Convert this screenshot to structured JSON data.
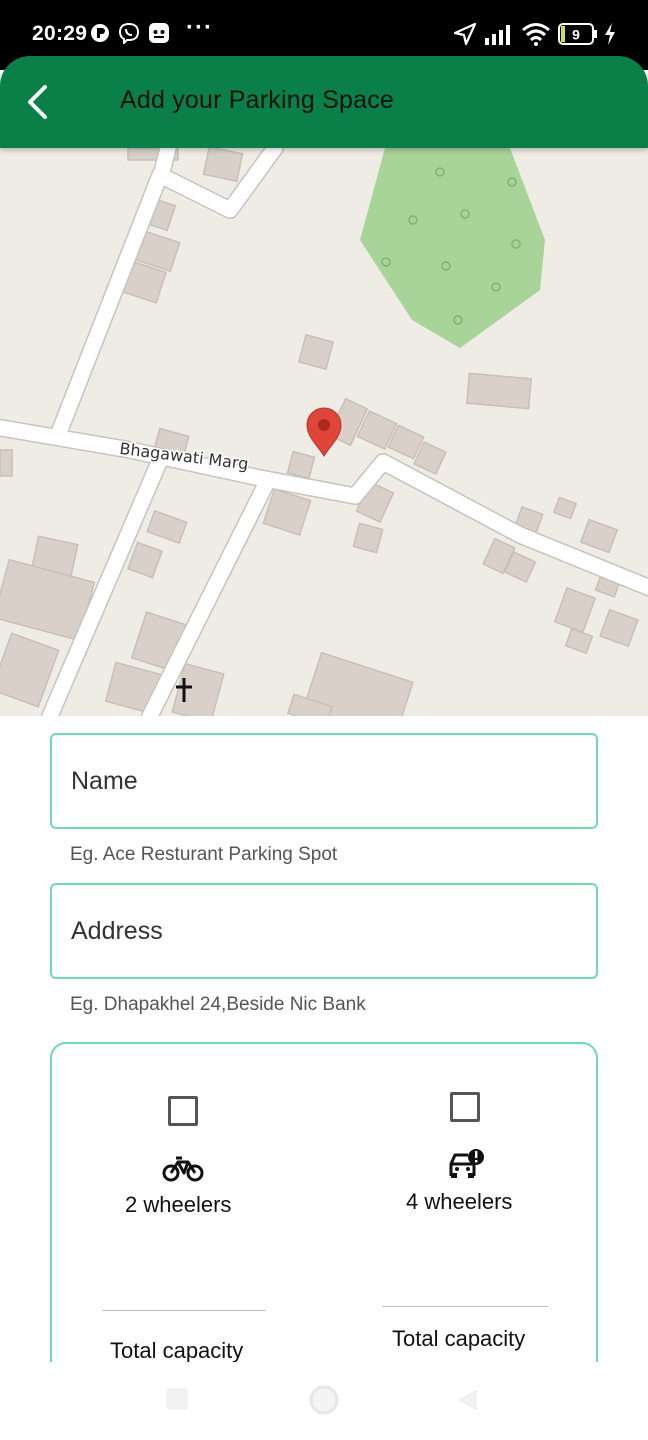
{
  "status_bar": {
    "time": "20:29",
    "battery_level": "9",
    "icons": [
      "messenger-icon",
      "viber-icon",
      "notification-icon",
      "more-dots-icon",
      "location-arrow-icon",
      "signal-icon",
      "wifi-icon",
      "battery-icon",
      "charging-icon"
    ]
  },
  "app_bar": {
    "title": "Add your Parking Space",
    "background_color": "#0a8048"
  },
  "map": {
    "street_label": "Bhagawati Marg",
    "marker_color": "#e0453a",
    "park_color": "#a8d49a"
  },
  "form": {
    "name_placeholder": "Name",
    "name_helper": "Eg. Ace Resturant Parking Spot",
    "address_placeholder": "Address",
    "address_helper": "Eg. Dhapakhel 24,Beside Nic Bank",
    "border_color": "#6fdcae",
    "two_wheelers": {
      "label": "2 wheelers",
      "checked": false,
      "capacity_label": "Total capacity"
    },
    "four_wheelers": {
      "label": "4 wheelers",
      "checked": false,
      "capacity_label": "Total capacity"
    }
  },
  "nav_bar": {
    "buttons": [
      "recent-apps",
      "home",
      "back"
    ]
  }
}
